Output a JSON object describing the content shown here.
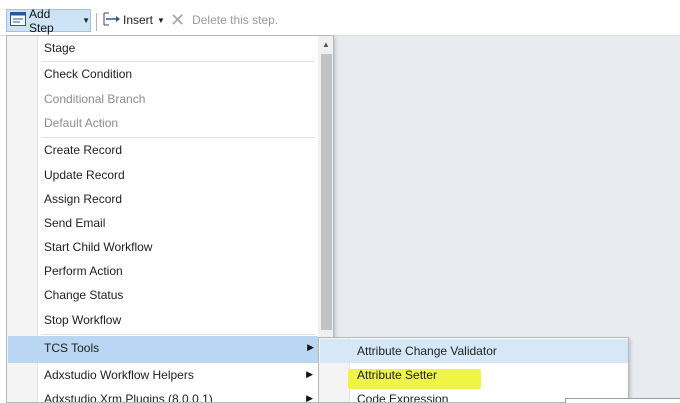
{
  "toolbar": {
    "add_step_label": "Add Step",
    "insert_label": "Insert",
    "delete_label": "Delete this step.",
    "icons": {
      "add_step": "add-step-icon",
      "insert": "insert-icon",
      "delete": "delete-x-icon"
    }
  },
  "menu": {
    "items": [
      {
        "label": "Stage",
        "disabled": false
      },
      {
        "label": "Check Condition",
        "disabled": false
      },
      {
        "label": "Conditional Branch",
        "disabled": true
      },
      {
        "label": "Default Action",
        "disabled": true
      },
      {
        "label": "Create Record",
        "disabled": false
      },
      {
        "label": "Update Record",
        "disabled": false
      },
      {
        "label": "Assign Record",
        "disabled": false
      },
      {
        "label": "Send Email",
        "disabled": false
      },
      {
        "label": "Start Child Workflow",
        "disabled": false
      },
      {
        "label": "Perform Action",
        "disabled": false
      },
      {
        "label": "Change Status",
        "disabled": false
      },
      {
        "label": "Stop Workflow",
        "disabled": false
      },
      {
        "label": "TCS Tools",
        "disabled": false,
        "submenu": true,
        "highlighted": true
      },
      {
        "label": "Adxstudio Workflow Helpers",
        "disabled": false,
        "submenu": true
      },
      {
        "label": "Adxstudio.Xrm.Plugins (8.0.0.1)",
        "disabled": false,
        "submenu": true
      }
    ]
  },
  "submenu": {
    "items": [
      {
        "label": "Attribute Change Validator"
      },
      {
        "label": "Attribute Setter"
      },
      {
        "label": "Code Expression"
      }
    ]
  },
  "colors": {
    "highlight": "#b9d7f2",
    "hover": "#d6e7f8",
    "marker": "#eef43a",
    "disabled_text": "#8c8c8c"
  }
}
